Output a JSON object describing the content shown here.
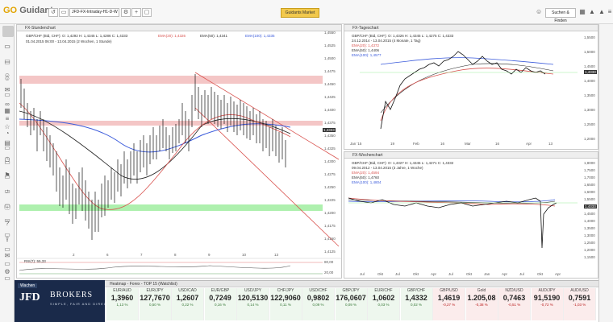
{
  "app": {
    "logo_text": "Guidants",
    "url_value": "JFD-FX-Intraday-H1-D-W",
    "markets_button": "Guidants Market",
    "search_button": "Suchen & Finden"
  },
  "main_chart": {
    "title": "FX-Stundenchart",
    "info_line1": "GBP/CHF (Bid, CHF): O: 1,4292  H: 1,4345  L: 1,4286  C: 1,4333",
    "info_line2": "01.04.2015 06:00 - 13.04.2015 (2 Wochen, 1 Stunde)",
    "ema20": "EMA(20): 1,4326",
    "ema50": "EMA(50): 1,4341",
    "ema100": "EMA(100): 1,4335",
    "y_ticks": [
      "1,4550",
      "1,4525",
      "1,4500",
      "1,4475",
      "1,4450",
      "1,4425",
      "1,4400",
      "1,4375",
      "1,4350",
      "1,4325",
      "1,4300",
      "1,4275",
      "1,4250",
      "1,4225",
      "1,4200",
      "1,4175",
      "1,4150",
      "1,4125"
    ],
    "x_ticks": [
      "2",
      "6",
      "7",
      "8",
      "9",
      "10",
      "13"
    ],
    "price_box": "1,4333",
    "rsi_label": "RSI(7): 55,33",
    "rsi_ticks": [
      "80,00",
      "20,00"
    ],
    "colors": {
      "ema20": "#d9534f",
      "ema50": "#222222",
      "ema100": "#3b5bdb",
      "resistance": "#f2b8b8",
      "support": "#9ee89e",
      "channel": "#d9534f"
    }
  },
  "daily_chart": {
    "title": "FX-Tageschart",
    "info_line1": "GBP/CHF (Bid, CHF): O: 1,4326  H: 1,4345  L: 1,4275  C: 1,4333",
    "info_line2": "24.12.2014 - 13.04.2015 (4 Monate, 1 Tag)",
    "ema20": "EMA(20): 1,4372",
    "ema50": "EMA(50): 1,4406",
    "ema100": "EMA(100): 1,4577",
    "y_ticks": [
      "1,5500",
      "1,5000",
      "1,4500",
      "1,4000",
      "1,3500",
      "1,3000",
      "1,2500",
      "1,2000"
    ],
    "x_ticks": [
      "Jan '15",
      "19",
      "Feb",
      "16",
      "Mar",
      "16",
      "Apr",
      "13"
    ],
    "price_box": "1,4333"
  },
  "weekly_chart": {
    "title": "FX-Wochenchart",
    "info_line1": "GBP/CHF (Bid, CHF): O: 1,4327  H: 1,4345  L: 1,4271  C: 1,4332",
    "info_line2": "09.04.2012 - 13.04.2015 (3 Jahre, 1 Woche)",
    "ema20": "EMA(20): 1,4594",
    "ema50": "EMA(50): 1,4760",
    "ema100": "EMA(100): 1,4804",
    "y_ticks": [
      "1,8000",
      "1,7500",
      "1,7000",
      "1,6500",
      "1,6000",
      "1,5500",
      "1,5000",
      "1,4500",
      "1,4000",
      "1,3500",
      "1,3000",
      "1,2500",
      "1,2000",
      "1,1500"
    ],
    "x_ticks": [
      "Jul",
      "Okt",
      "Jul",
      "Okt",
      "Apr",
      "Jul",
      "Okt",
      "Jan",
      "Apr",
      "Jul",
      "Okt",
      "Apr"
    ],
    "price_box": "1,4333"
  },
  "ticker": {
    "header": "Heatmap - Forex - TOP 15 (Watchlist)",
    "items": [
      {
        "name": "EUR/AUD",
        "price": "1,3960",
        "change": "1,13 %",
        "dir": "pos"
      },
      {
        "name": "EUR/JPY",
        "price": "127,7670",
        "change": "0,50 %",
        "dir": "pos"
      },
      {
        "name": "USD/CAD",
        "price": "1,2607",
        "change": "0,22 %",
        "dir": "pos"
      },
      {
        "name": "EUR/GBP",
        "price": "0,7249",
        "change": "0,16 %",
        "dir": "pos"
      },
      {
        "name": "USD/JPY",
        "price": "120,5130",
        "change": "0,14 %",
        "dir": "pos"
      },
      {
        "name": "CHF/JPY",
        "price": "122,9060",
        "change": "0,11 %",
        "dir": "pos"
      },
      {
        "name": "USD/CHF",
        "price": "0,9802",
        "change": "0,09 %",
        "dir": "pos"
      },
      {
        "name": "GBP/JPY",
        "price": "176,0607",
        "change": "0,09 %",
        "dir": "pos"
      },
      {
        "name": "EUR/CHF",
        "price": "1,0602",
        "change": "0,03 %",
        "dir": "pos"
      },
      {
        "name": "GBP/CHF",
        "price": "1,4332",
        "change": "0,02 %",
        "dir": "pos"
      },
      {
        "name": "GBP/USD",
        "price": "1,4619",
        "change": "-0,27 %",
        "dir": "neg"
      },
      {
        "name": "Gold",
        "price": "1.205,08",
        "change": "-0,38 %",
        "dir": "neg"
      },
      {
        "name": "NZD/USD",
        "price": "0,7463",
        "change": "-0,51 %",
        "dir": "neg"
      },
      {
        "name": "AUD/JPY",
        "price": "91,5190",
        "change": "-0,72 %",
        "dir": "neg"
      },
      {
        "name": "AUD/USD",
        "price": "0,7591",
        "change": "-1,03 %",
        "dir": "neg"
      }
    ]
  },
  "brand": {
    "jfd": "JFD",
    "brokers": "BROKERS",
    "sub": "SIMPLE, FAIR AND DIRECT",
    "watchlist": "Wachen"
  }
}
